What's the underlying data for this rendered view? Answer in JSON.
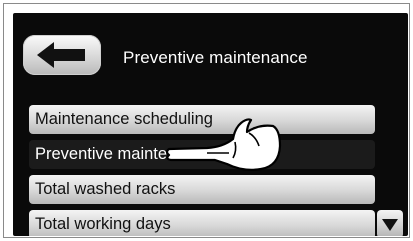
{
  "header": {
    "back_icon": "back-arrow-icon",
    "title": "Preventive maintenance"
  },
  "menu": {
    "items": [
      {
        "label": "Maintenance scheduling",
        "selected": false
      },
      {
        "label": "Preventive maintenance mode",
        "selected": true
      },
      {
        "label": "Total washed racks",
        "selected": false
      },
      {
        "label": "Total working days",
        "selected": false
      }
    ]
  },
  "scroll": {
    "icon": "triangle-down-icon"
  },
  "pointer": {
    "icon": "pointing-hand-icon"
  },
  "colors": {
    "screen_background": "#0a0a0a",
    "selected_item": "#1b1b1b",
    "button_light": "#f4f4f4",
    "button_dark": "#b8b8b8"
  }
}
